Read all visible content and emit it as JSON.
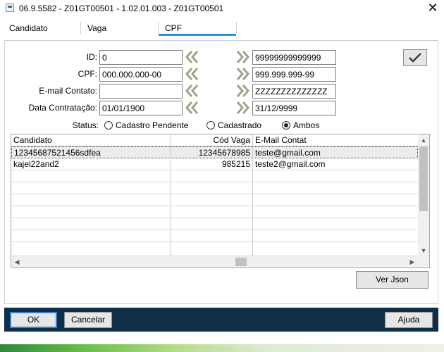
{
  "window": {
    "title": "06.9.5582 - Z01GT00501 - 1.02.01.003 - Z01GT00501",
    "close_glyph": "✕"
  },
  "tabs": [
    {
      "label": "Candidato",
      "active": false
    },
    {
      "label": "Vaga",
      "active": false
    },
    {
      "label": "CPF",
      "active": true
    }
  ],
  "accent_color": "#2f8fd6",
  "filters": {
    "id": {
      "label": "ID:",
      "from": "0",
      "to": "99999999999999"
    },
    "cpf": {
      "label": "CPF:",
      "from": "000.000.000-00",
      "to": "999.999.999-99"
    },
    "email": {
      "label": "E-mail Contato:",
      "from": "",
      "to": "ZZZZZZZZZZZZZZ"
    },
    "data": {
      "label": "Data Contratação:",
      "from": "01/01/1900",
      "to": "31/12/9999"
    }
  },
  "icons": {
    "from_chevron": "double-chevron-left-icon",
    "to_chevron": "double-chevron-right-icon",
    "confirm": "checkmark-icon"
  },
  "status": {
    "label": "Status:",
    "options": [
      {
        "label": "Cadastro Pendente",
        "selected": false
      },
      {
        "label": "Cadastrado",
        "selected": false
      },
      {
        "label": "Ambos",
        "selected": true
      }
    ]
  },
  "grid": {
    "columns": [
      "Candidato",
      "Cód Vaga",
      "E-Mail Contat"
    ],
    "rows": [
      {
        "candidato": "12345687521456sdfea",
        "cod_vaga": "12345678985",
        "email": "teste@gmail.com",
        "selected": true
      },
      {
        "candidato": "kajei22and2",
        "cod_vaga": "985215",
        "email": "teste2@gmail.com",
        "selected": false
      }
    ]
  },
  "buttons": {
    "ver_json": "Ver Json",
    "ok": "OK",
    "cancelar": "Cancelar",
    "ajuda": "Ajuda"
  }
}
